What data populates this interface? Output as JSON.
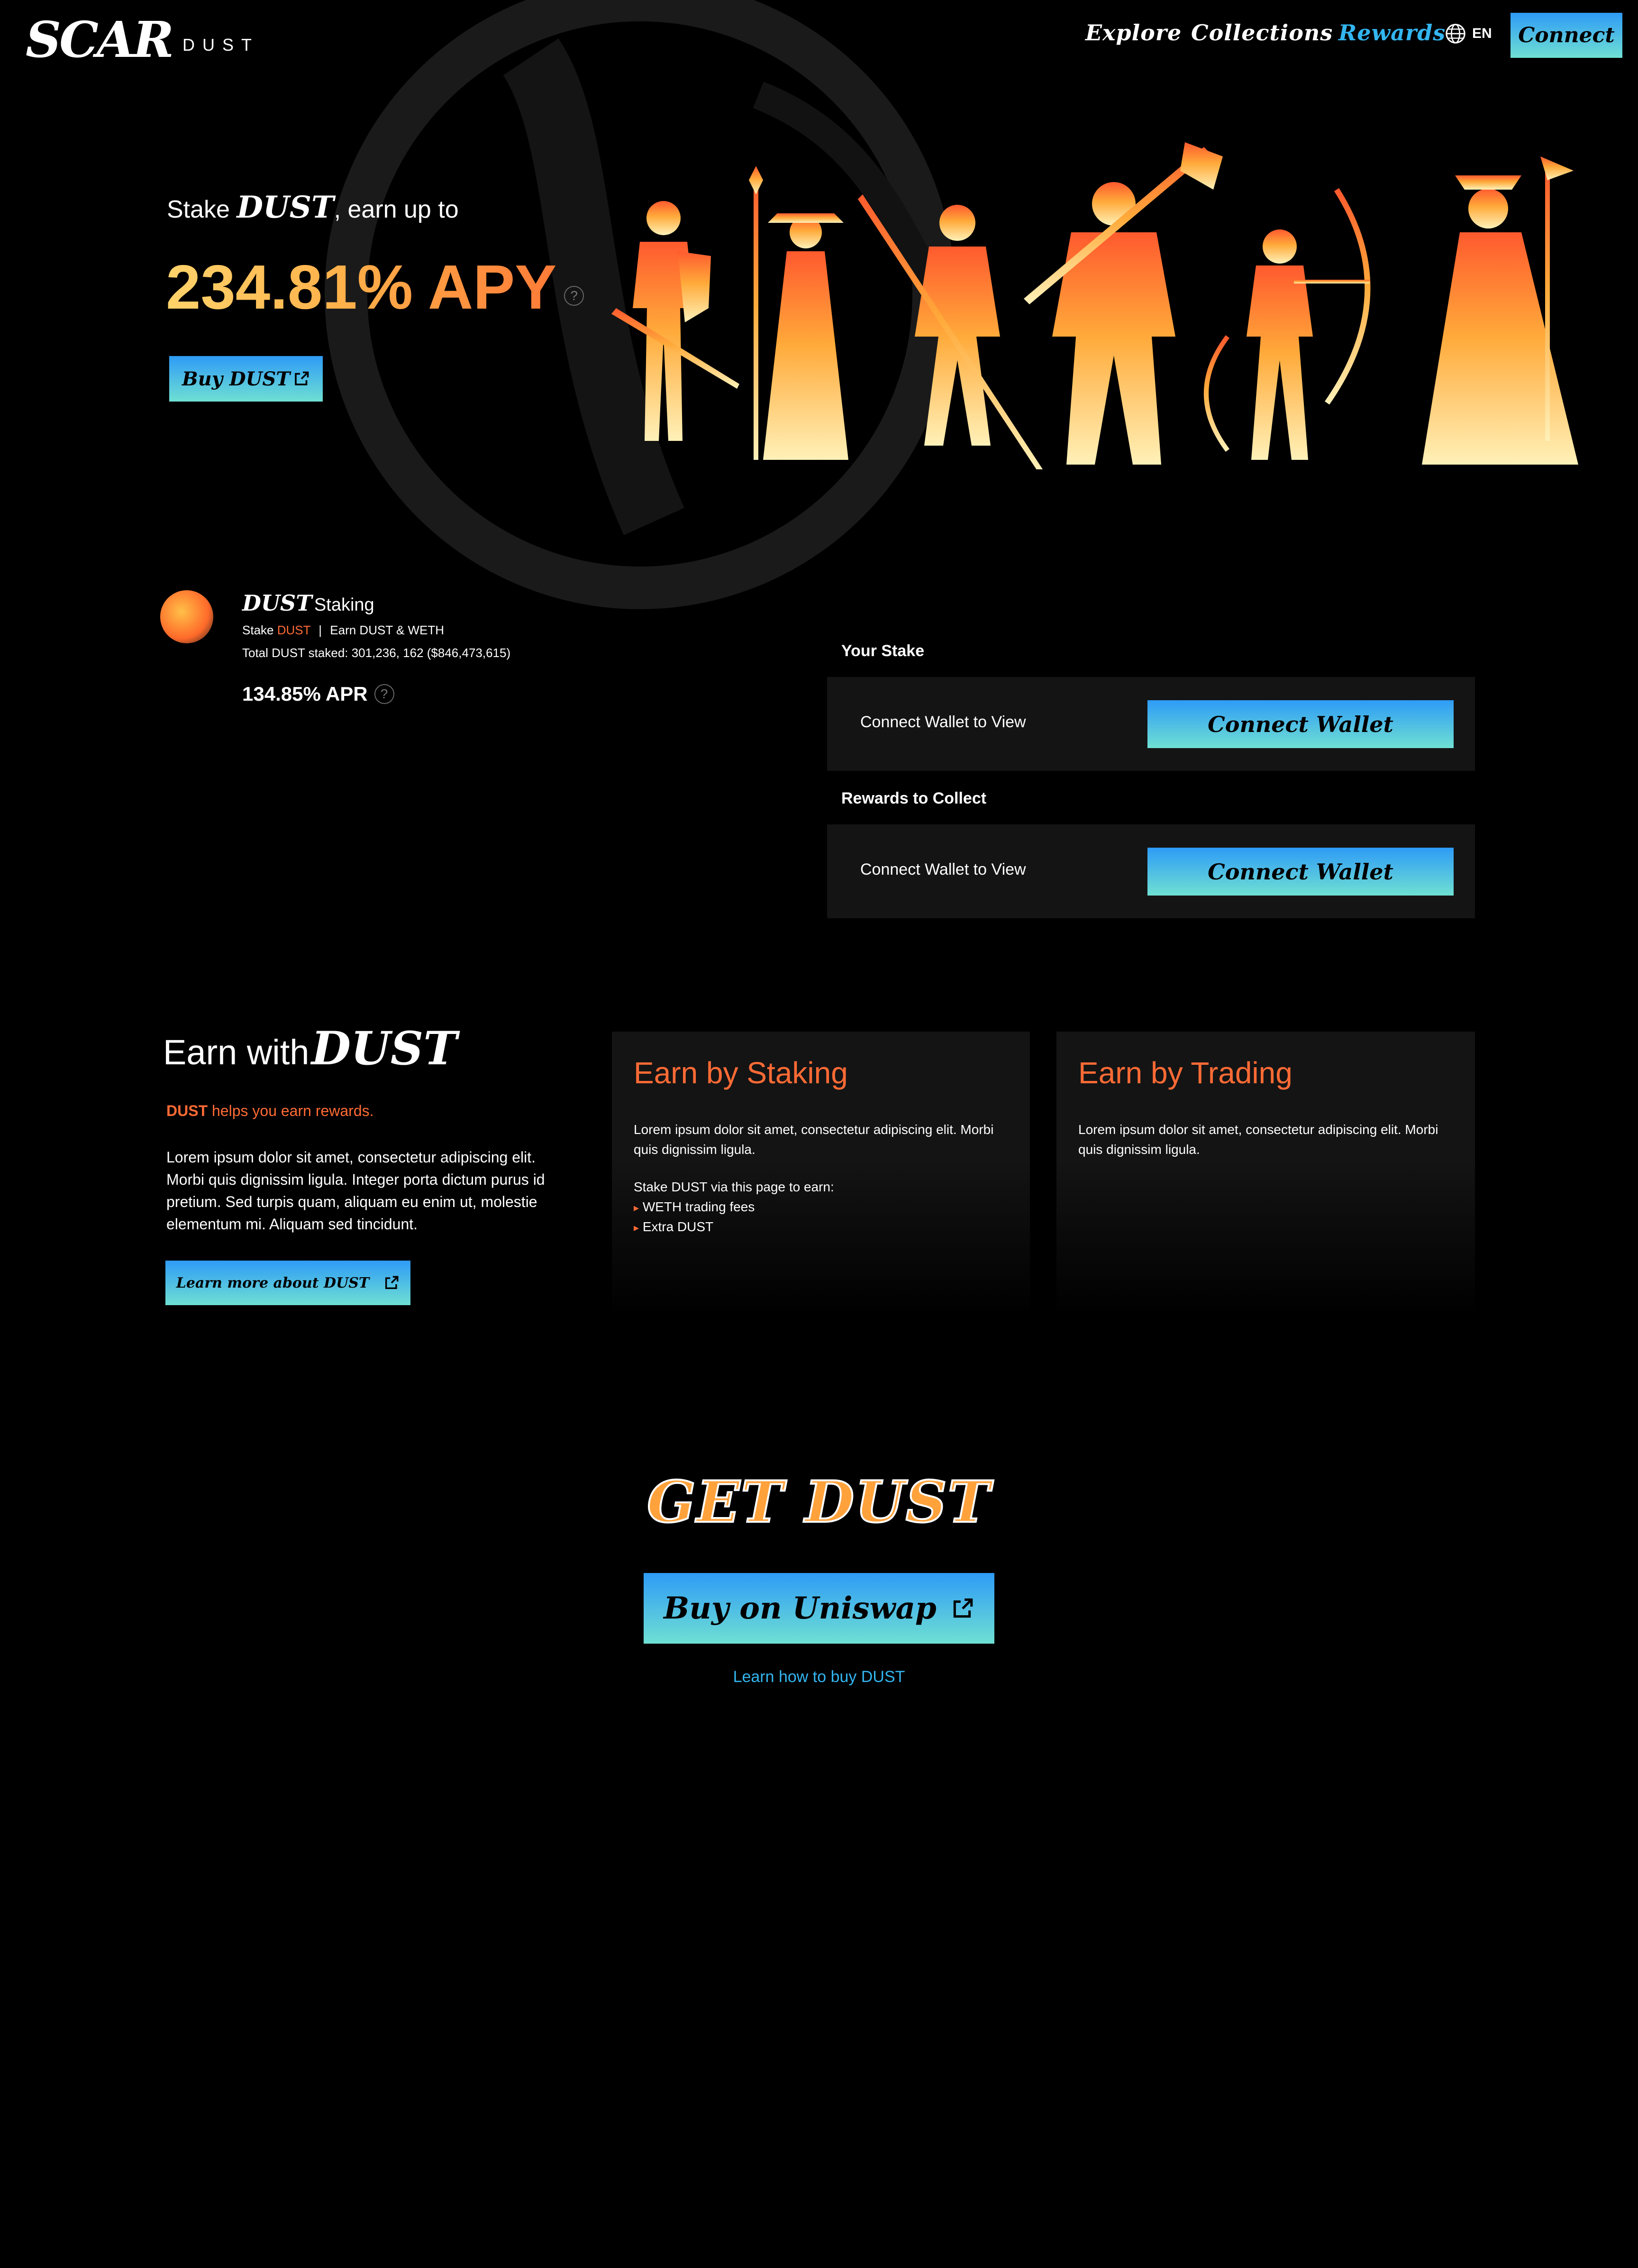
{
  "header": {
    "logo_main": "SCAR",
    "logo_sub": "DUST",
    "nav": [
      "Explore",
      "Collections",
      "Rewards"
    ],
    "active_nav": "Rewards",
    "lang": "EN",
    "connect_label": "Connect"
  },
  "hero": {
    "stake_prefix": "Stake",
    "stake_token": "DUST",
    "stake_suffix": ", earn up to",
    "apy": "234.81% APY",
    "buy_label": "Buy DUST"
  },
  "staking": {
    "title_token": "DUST",
    "title_word": "Staking",
    "sub_prefix": "Stake",
    "sub_token": "DUST",
    "sub_suffix": "Earn DUST & WETH",
    "total": "Total DUST staked: 301,236, 162 ($846,473,615)",
    "apr": "134.85% APR",
    "your_stake_label": "Your Stake",
    "rewards_label": "Rewards to Collect",
    "connect_view": "Connect Wallet to View",
    "connect_wallet": "Connect Wallet"
  },
  "earn": {
    "title_prefix": "Earn with",
    "title_token": "DUST",
    "tag_token": "DUST",
    "tag_rest": "helps you earn rewards.",
    "body": "Lorem ipsum dolor sit amet, consectetur adipiscing elit. Morbi quis dignissim ligula. Integer porta dictum purus id pretium. Sed turpis quam, aliquam eu enim ut, molestie elementum mi. Aliquam sed tincidunt.",
    "learn_label": "Learn more about DUST",
    "cards": [
      {
        "title": "Earn by Staking",
        "body": "Lorem ipsum dolor sit amet, consectetur adipiscing elit. Morbi quis dignissim ligula.",
        "intro": "Stake DUST via this page to earn:",
        "bullets": [
          "WETH trading fees",
          "Extra DUST"
        ]
      },
      {
        "title": "Earn by Trading",
        "body": "Lorem ipsum dolor sit amet, consectetur adipiscing elit. Morbi quis dignissim ligula."
      }
    ]
  },
  "get": {
    "title": "GET DUST",
    "button": "Buy on Uniswap",
    "link": "Learn how to buy DUST"
  },
  "colors": {
    "accent_orange": "#ff6b35",
    "accent_blue": "#33b5f0",
    "button_gradient": [
      "#2e9bf6",
      "#6fe0d3"
    ],
    "panel": "#141414"
  }
}
